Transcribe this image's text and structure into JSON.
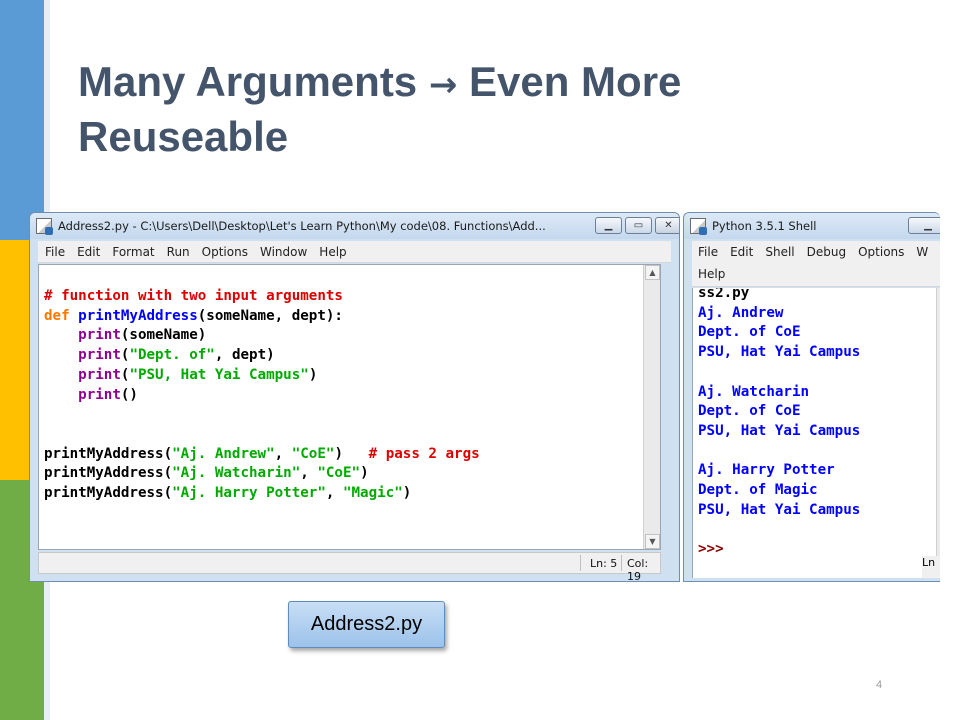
{
  "slide": {
    "title_line1_a": "Many Arguments ",
    "title_arrow": "→",
    "title_line1_b": " Even More",
    "title_line2": "Reuseable",
    "caption": "Address2.py",
    "page_number": "4",
    "colors": {
      "stripe_blue": "#5b9bd5",
      "stripe_yellow": "#ffc000",
      "stripe_green": "#70ad47",
      "title": "#44546a"
    }
  },
  "editor_window": {
    "title": "Address2.py - C:\\Users\\Dell\\Desktop\\Let's Learn Python\\My code\\08. Functions\\Add...",
    "menu": [
      "File",
      "Edit",
      "Format",
      "Run",
      "Options",
      "Window",
      "Help"
    ],
    "buttons": {
      "minimize": "▁",
      "maximize": "▭",
      "close": "✕"
    },
    "code": {
      "comment1": "# function with two input arguments",
      "def_kw": "def",
      "fn_name": "printMyAddress",
      "def_params": "(someName, dept):",
      "print1_kw": "print",
      "print1_rest": "(someName)",
      "print2_kw": "print",
      "print2_str": "\"Dept. of\"",
      "print2_rest": ", dept)",
      "print3_kw": "print",
      "print3_str": "\"PSU, Hat Yai Campus\"",
      "print4_kw": "print",
      "print4_rest": "()",
      "call1_fn": "printMyAddress(",
      "call1_a": "\"Aj. Andrew\"",
      "call1_b": "\"CoE\"",
      "call1_comment": "# pass 2 args",
      "call2_fn": "printMyAddress(",
      "call2_a": "\"Aj. Watcharin\"",
      "call2_b": "\"CoE\"",
      "call3_fn": "printMyAddress(",
      "call3_a": "\"Aj. Harry Potter\"",
      "call3_b": "\"Magic\""
    },
    "status": {
      "line": "Ln: 5",
      "col": "Col: 19"
    }
  },
  "shell_window": {
    "title": "Python 3.5.1 Shell",
    "menu_row1": [
      "File",
      "Edit",
      "Shell",
      "Debug",
      "Options",
      "W"
    ],
    "menu_row2": [
      "Help"
    ],
    "output": [
      "ss2.py",
      "Aj. Andrew",
      "Dept. of CoE",
      "PSU, Hat Yai Campus",
      "",
      "Aj. Watcharin",
      "Dept. of CoE",
      "PSU, Hat Yai Campus",
      "",
      "Aj. Harry Potter",
      "Dept. of Magic",
      "PSU, Hat Yai Campus",
      ""
    ],
    "prompt": ">>>",
    "status": "Ln"
  }
}
